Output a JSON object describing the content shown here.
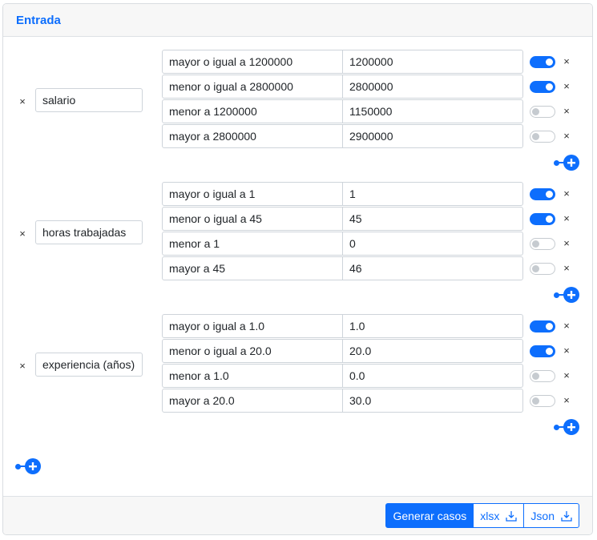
{
  "panel": {
    "title": "Entrada"
  },
  "variables": [
    {
      "name": "salario",
      "conditions": [
        {
          "label": "mayor o igual a 1200000",
          "value": "1200000",
          "enabled": true
        },
        {
          "label": "menor o igual a 2800000",
          "value": "2800000",
          "enabled": true
        },
        {
          "label": "menor a 1200000",
          "value": "1150000",
          "enabled": false
        },
        {
          "label": "mayor a 2800000",
          "value": "2900000",
          "enabled": false
        }
      ]
    },
    {
      "name": "horas trabajadas",
      "conditions": [
        {
          "label": "mayor o igual a 1",
          "value": "1",
          "enabled": true
        },
        {
          "label": "menor o igual a 45",
          "value": "45",
          "enabled": true
        },
        {
          "label": "menor a 1",
          "value": "0",
          "enabled": false
        },
        {
          "label": "mayor a 45",
          "value": "46",
          "enabled": false
        }
      ]
    },
    {
      "name": "experiencia (años)",
      "conditions": [
        {
          "label": "mayor o igual a 1.0",
          "value": "1.0",
          "enabled": true
        },
        {
          "label": "menor o igual a 20.0",
          "value": "20.0",
          "enabled": true
        },
        {
          "label": "menor a 1.0",
          "value": "0.0",
          "enabled": false
        },
        {
          "label": "mayor a 20.0",
          "value": "30.0",
          "enabled": false
        }
      ]
    }
  ],
  "icons": {
    "remove": "close-icon",
    "add": "plus-circle-icon",
    "download": "download-icon"
  },
  "remove_glyph": "×",
  "footer": {
    "generate_label": "Generar casos",
    "xlsx_label": "xlsx",
    "json_label": "Json"
  },
  "colors": {
    "accent": "#0d6efd",
    "toggle_off": "#c6cbd0",
    "header_bg": "#f7f7f7"
  }
}
